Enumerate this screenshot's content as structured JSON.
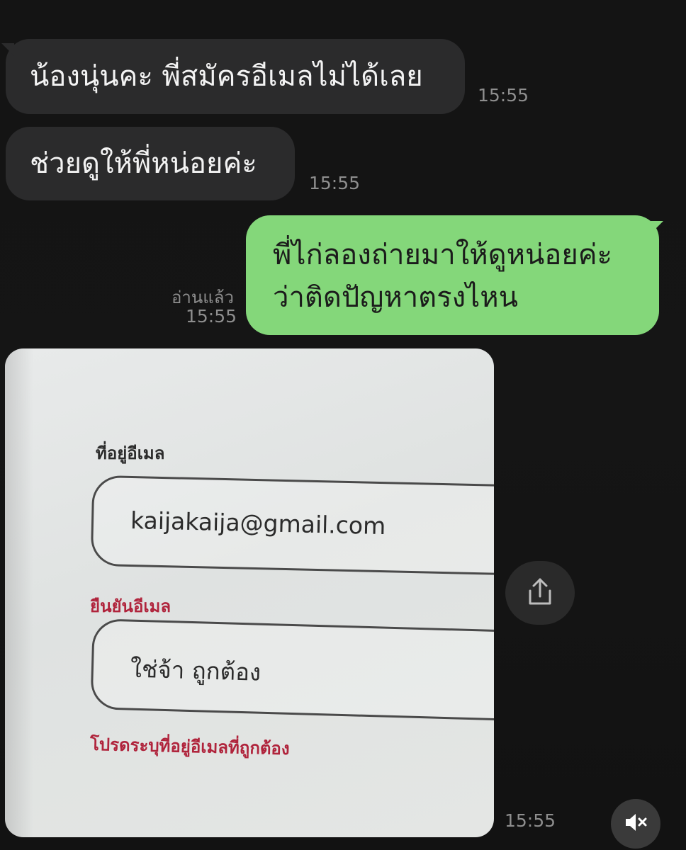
{
  "chat": {
    "messages": [
      {
        "direction": "incoming",
        "text": "น้องนุ่นคะ พี่สมัครอีเมลไม่ได้เลย",
        "time": "15:55"
      },
      {
        "direction": "incoming",
        "text": "ช่วยดูให้พี่หน่อยค่ะ",
        "time": "15:55"
      },
      {
        "direction": "outgoing",
        "lines": [
          "พี่ไก่ลองถ่ายมาให้ดูหน่อยค่ะ",
          "ว่าติดปัญหาตรงไหน"
        ],
        "read_status": "อ่านแล้ว",
        "time": "15:55"
      }
    ],
    "photo_message": {
      "time": "15:55",
      "email_label": "ที่อยู่อีเมล",
      "email_value": "kaijakaija@gmail.com",
      "confirm_label": "ยืนยันอีเมล",
      "confirm_value": "ใช่จ้า ถูกต้อง",
      "error_text": "โปรดระบุที่อยู่อีเมลที่ถูกต้อง"
    }
  },
  "controls": {
    "share_icon": "share-icon",
    "mute_icon": "mute-icon"
  },
  "colors": {
    "background": "#141414",
    "incoming_bubble": "#2b2b2c",
    "outgoing_bubble": "#84d77a",
    "timestamp": "#8e8e8e",
    "error_red": "#b0243c"
  }
}
